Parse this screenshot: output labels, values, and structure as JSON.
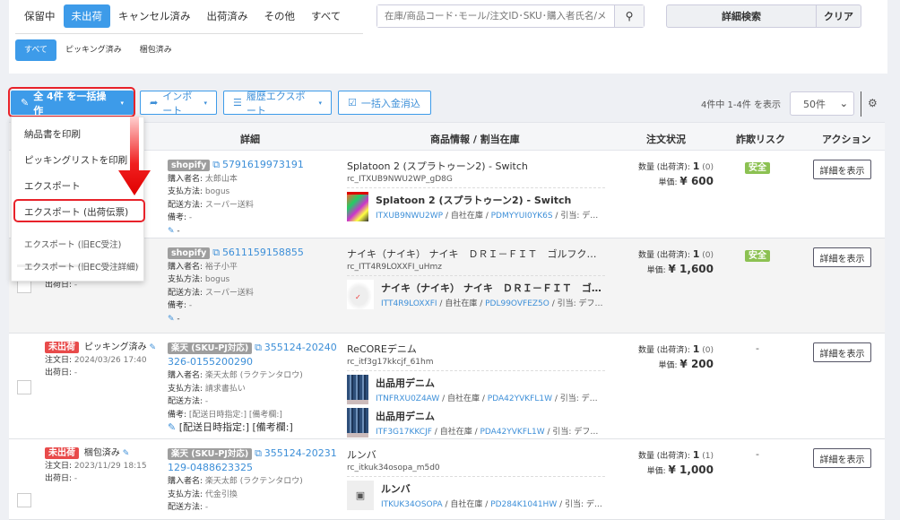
{
  "tabs": [
    "保留中",
    "未出荷",
    "キャンセル済み",
    "出荷済み",
    "その他",
    "すべて"
  ],
  "active_tab": 1,
  "sub_tabs": [
    "すべて",
    "ピッキング済み",
    "梱包済み"
  ],
  "search": {
    "placeholder": "在庫/商品コード･モール/注文ID･SKU･購入者氏名/メ"
  },
  "advanced_search": "詳細検索",
  "clear": "クリア",
  "toolbar": {
    "bulk": "全 4件 を一括操作",
    "import": "インポート",
    "history_export": "履歴エクスポート",
    "bulk_payment": "一括入金消込"
  },
  "count_text": "4件中 1-4件 を表示",
  "per_page": "50件",
  "headers": {
    "detail": "詳細",
    "product": "商品情報 / 割当在庫",
    "status": "注文状況",
    "fraud": "詐欺リスク",
    "action": "アクション"
  },
  "menu": [
    "納品書を印刷",
    "ピッキングリストを印刷",
    "エクスポート",
    "エクスポート (出荷伝票)",
    "エクスポート (旧EC受注)",
    "エクスポート (旧EC受注詳細)"
  ],
  "labels": {
    "buyer": "購入者名: ",
    "payment": "支払方法: ",
    "shipping": "配送方法: ",
    "note": "備考: ",
    "order_date": "注文日: ",
    "ship_date": "出荷日: ",
    "qty": "数量 (出荷済): ",
    "price": "単価: ",
    "detail_btn": "詳細を表示",
    "stock": "自社在庫",
    "alloc": "引当: "
  },
  "orders": [
    {
      "mall": "shopify",
      "order_id": "5791619973191",
      "buyer": "太郎山本",
      "payment": "bogus",
      "shipping": "スーパー送料",
      "note": "-",
      "memo": "-",
      "product_title": "Splatoon 2 (スプラトゥーン2) - Switch",
      "product_code": "rc_ITXUB9NWU2WP_gD8G",
      "items": [
        {
          "name": "Splatoon 2 (スプラトゥーン2) - Switch",
          "code": "ITXUB9NWU2WP",
          "loc": "PDMYYUI0YK6S",
          "alloc": "デフォル...",
          "thumb": "game"
        }
      ],
      "qty": "1",
      "shipped": "(0)",
      "price": "¥ 600",
      "fraud": "安全"
    },
    {
      "mall": "shopify",
      "order_id": "5611159158855",
      "buyer": "裕子小平",
      "payment": "bogus",
      "shipping": "スーパー送料",
      "note": "-",
      "memo": "-",
      "ship_date": "-",
      "product_title": "ナイキ（ナイキ） ナイキ　ＤＲＩ－ＦＩＴ　ゴルフクラシック...",
      "product_code": "rc_ITT4R9LOXXFI_uHmz",
      "items": [
        {
          "name": "ナイキ（ナイキ） ナイキ　ＤＲＩ－ＦＩＴ　ゴルフク...",
          "code": "ITT4R9LOXXFI",
          "loc": "PDL99OVFEZ5O",
          "alloc": "デフォルト /...",
          "thumb": "cap"
        }
      ],
      "qty": "1",
      "shipped": "(0)",
      "price": "¥ 1,600",
      "fraud": "安全"
    },
    {
      "status": "未出荷",
      "sub_status": "ピッキング済み",
      "order_date": "2024/03/26 17:40",
      "ship_date": "-",
      "mall": "楽天 (SKU-PJ対応)",
      "order_id": "355124-20240326-0155200290",
      "buyer": "楽天太郎 (ラクテンタロウ)",
      "payment": "請求書払い",
      "shipping": "-",
      "note": "[配送日時指定:] [備考欄:]",
      "memo": "[配送日時指定:] [備考欄:]",
      "product_title": "ReCOREデニム",
      "product_code": "rc_itf3g17kkcjf_61hm",
      "items": [
        {
          "name": "出品用デニム",
          "code": "ITNFRXU0Z4AW",
          "loc": "PDA42YVKFL1W",
          "alloc": "デフォル...",
          "thumb": "denim"
        },
        {
          "name": "出品用デニム",
          "code": "ITF3G17KKCJF",
          "loc": "PDA42YVKFL1W",
          "alloc": "デフォルト /...",
          "thumb": "denim"
        }
      ],
      "qty": "1",
      "shipped": "(0)",
      "price": "¥ 200",
      "fraud": "-"
    },
    {
      "status": "未出荷",
      "sub_status": "梱包済み",
      "order_date": "2023/11/29 18:15",
      "ship_date": "-",
      "mall": "楽天 (SKU-PJ対応)",
      "order_id": "355124-20231129-0488623325",
      "buyer": "楽天太郎 (ラクテンタロウ)",
      "payment": "代金引換",
      "shipping": "-",
      "note": "",
      "memo": "",
      "product_title": "ルンバ",
      "product_code": "rc_itkuk34osopa_m5d0",
      "items": [
        {
          "name": "ルンバ",
          "code": "ITKUK34OSOPA",
          "loc": "PD284K1041HW",
          "alloc": "デフォル...",
          "thumb": "none"
        }
      ],
      "qty": "1",
      "shipped": "(1)",
      "price": "¥ 1,000",
      "fraud": "-"
    }
  ]
}
